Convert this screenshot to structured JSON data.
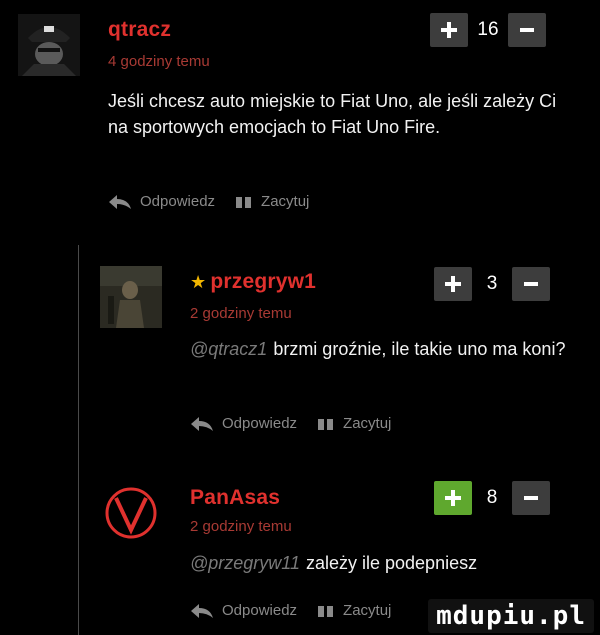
{
  "comments": [
    {
      "author": "qtracz",
      "time": "4 godziny temu",
      "mention": "",
      "text": "Jeśli chcesz auto miejskie to Fiat Uno, ale jeśli zależy Ci na sportowych emocjach to Fiat Uno Fire.",
      "votes": "16",
      "starred": false,
      "plus_active": false,
      "reply_label": "Odpowiedz",
      "quote_label": "Zacytuj"
    },
    {
      "author": "przegryw1",
      "time": "2 godziny temu",
      "mention": "@qtracz1",
      "text": "brzmi groźnie, ile takie uno ma koni?",
      "votes": "3",
      "starred": true,
      "plus_active": false,
      "reply_label": "Odpowiedz",
      "quote_label": "Zacytuj"
    },
    {
      "author": "PanAsas",
      "time": "2 godziny temu",
      "mention": "@przegryw11",
      "text": "zależy ile podepniesz",
      "votes": "8",
      "starred": false,
      "plus_active": true,
      "reply_label": "Odpowiedz",
      "quote_label": "Zacytuj"
    }
  ],
  "watermark": "mdupiu.pl",
  "colors": {
    "author": "#e0312e",
    "upvote_active": "#5fa82e",
    "vote_button": "#3d3d3d",
    "star": "#f2b600"
  }
}
